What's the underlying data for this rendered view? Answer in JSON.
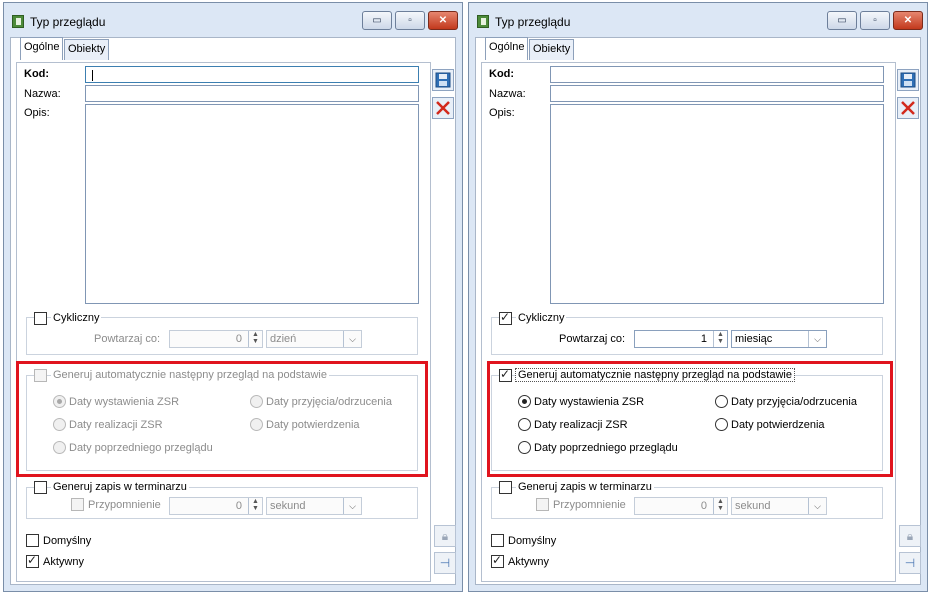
{
  "windows": [
    {
      "title": "Typ przeglądu",
      "controls": {
        "minimize": "▭",
        "maximize": "▫",
        "close": "✕"
      },
      "tabs": [
        {
          "label": "Ogólne",
          "active": true
        },
        {
          "label": "Obiekty",
          "active": false
        }
      ],
      "fields": {
        "kod_label": "Kod:",
        "nazwa_label": "Nazwa:",
        "opis_label": "Opis:",
        "kod_value": "",
        "nazwa_value": "",
        "opis_value": ""
      },
      "cykliczny": {
        "label": "Cykliczny",
        "checked": false
      },
      "repeat": {
        "label": "Powtarzaj co:",
        "value": "0",
        "unit": "dzień",
        "enabled": false
      },
      "generuj": {
        "label": "Generuj automatycznie następny przegląd na podstawie",
        "checked": false,
        "enabled": false,
        "options": [
          "Daty wystawienia ZSR",
          "Daty przyjęcia/odrzucenia",
          "Daty realizacji ZSR",
          "Daty potwierdzenia",
          "Daty poprzedniego przeglądu"
        ],
        "selected": "Daty wystawienia ZSR"
      },
      "terminarz": {
        "label": "Generuj zapis w terminarzu",
        "checked": false,
        "reminder_label": "Przypomnienie",
        "reminder_checked": false,
        "reminder_value": "0",
        "reminder_unit": "sekund"
      },
      "domyslny": {
        "label": "Domyślny",
        "checked": false
      },
      "aktywny": {
        "label": "Aktywny",
        "checked": true
      }
    },
    {
      "title": "Typ przeglądu",
      "controls": {
        "minimize": "▭",
        "maximize": "▫",
        "close": "✕"
      },
      "tabs": [
        {
          "label": "Ogólne",
          "active": true
        },
        {
          "label": "Obiekty",
          "active": false
        }
      ],
      "fields": {
        "kod_label": "Kod:",
        "nazwa_label": "Nazwa:",
        "opis_label": "Opis:",
        "kod_value": "",
        "nazwa_value": "",
        "opis_value": ""
      },
      "cykliczny": {
        "label": "Cykliczny",
        "checked": true
      },
      "repeat": {
        "label": "Powtarzaj co:",
        "value": "1",
        "unit": "miesiąc",
        "enabled": true
      },
      "generuj": {
        "label": "Generuj automatycznie następny przegląd na podstawie",
        "checked": true,
        "enabled": true,
        "options": [
          "Daty wystawienia ZSR",
          "Daty przyjęcia/odrzucenia",
          "Daty realizacji ZSR",
          "Daty potwierdzenia",
          "Daty poprzedniego przeglądu"
        ],
        "selected": "Daty wystawienia ZSR"
      },
      "terminarz": {
        "label": "Generuj zapis w terminarzu",
        "checked": false,
        "reminder_label": "Przypomnienie",
        "reminder_checked": false,
        "reminder_value": "0",
        "reminder_unit": "sekund"
      },
      "domyslny": {
        "label": "Domyślny",
        "checked": false
      },
      "aktywny": {
        "label": "Aktywny",
        "checked": true
      }
    }
  ],
  "colors": {
    "highlight": "#e0141e",
    "accent": "#3c7fb1"
  }
}
